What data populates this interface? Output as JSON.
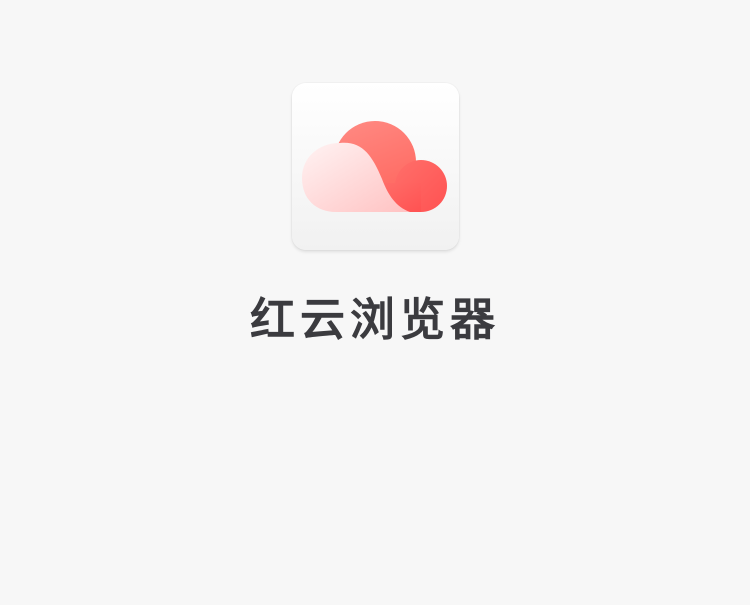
{
  "app": {
    "name": "红云浏览器",
    "icon": "cloud-icon",
    "colors": {
      "background": "#f7f7f7",
      "title": "#3b3b3f",
      "cloud_red": "#ff5c5c",
      "cloud_coral": "#ff8a80",
      "cloud_pink": "#ffd6d6"
    }
  }
}
